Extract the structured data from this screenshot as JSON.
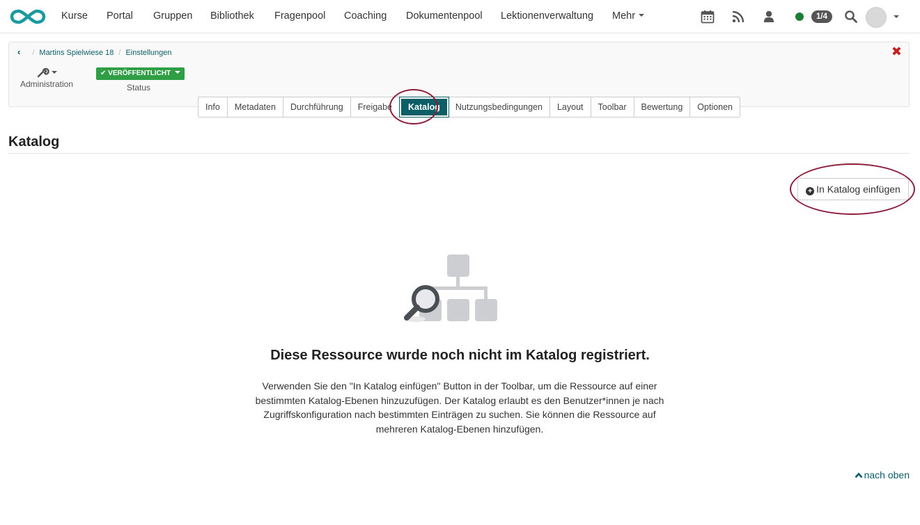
{
  "nav": {
    "items": [
      "Kurse",
      "Portal",
      "Gruppen",
      "Bibliothek",
      "Fragenpool",
      "Coaching",
      "Dokumentenpool",
      "Lektionenverwaltung",
      "Mehr"
    ],
    "session_count": "1/4",
    "icons": [
      "logo-infinity-icon",
      "calendar-icon",
      "rss-icon",
      "user-icon",
      "online-status-icon",
      "search-icon",
      "avatar"
    ]
  },
  "breadcrumb": {
    "back": "‹",
    "items": [
      "Martins Spielwiese 18",
      "Einstellungen"
    ]
  },
  "toolbar": {
    "administration_label": "Administration",
    "status_button": "✔ VERÖFFENTLICHT",
    "status_label": "Status",
    "close": "✖"
  },
  "tabs": [
    "Info",
    "Metadaten",
    "Durchführung",
    "Freigabe",
    "Katalog",
    "Nutzungsbedingungen",
    "Layout",
    "Toolbar",
    "Bewertung",
    "Optionen"
  ],
  "active_tab": "Katalog",
  "page": {
    "title": "Katalog",
    "add_button": "In Katalog einfügen"
  },
  "empty_state": {
    "title": "Diese Ressource wurde noch nicht im Katalog registriert.",
    "description": "Verwenden Sie den \"In Katalog einfügen\" Button in der Toolbar, um die Ressource auf einer bestimmten Katalog-Ebenen hinzuzufügen. Der Katalog erlaubt es den Benutzer*innen je nach Zugriffskonfiguration nach bestimmten Einträgen zu suchen. Sie können die Ressource auf mehreren Katalog-Ebenen hinzufügen."
  },
  "footer": {
    "to_top": "nach oben"
  },
  "colors": {
    "brand": "#1a9a9e",
    "accent": "#0c5f66",
    "published": "#2f9e44",
    "close": "#c71e1e",
    "highlight_ring": "#8c1c3a"
  }
}
